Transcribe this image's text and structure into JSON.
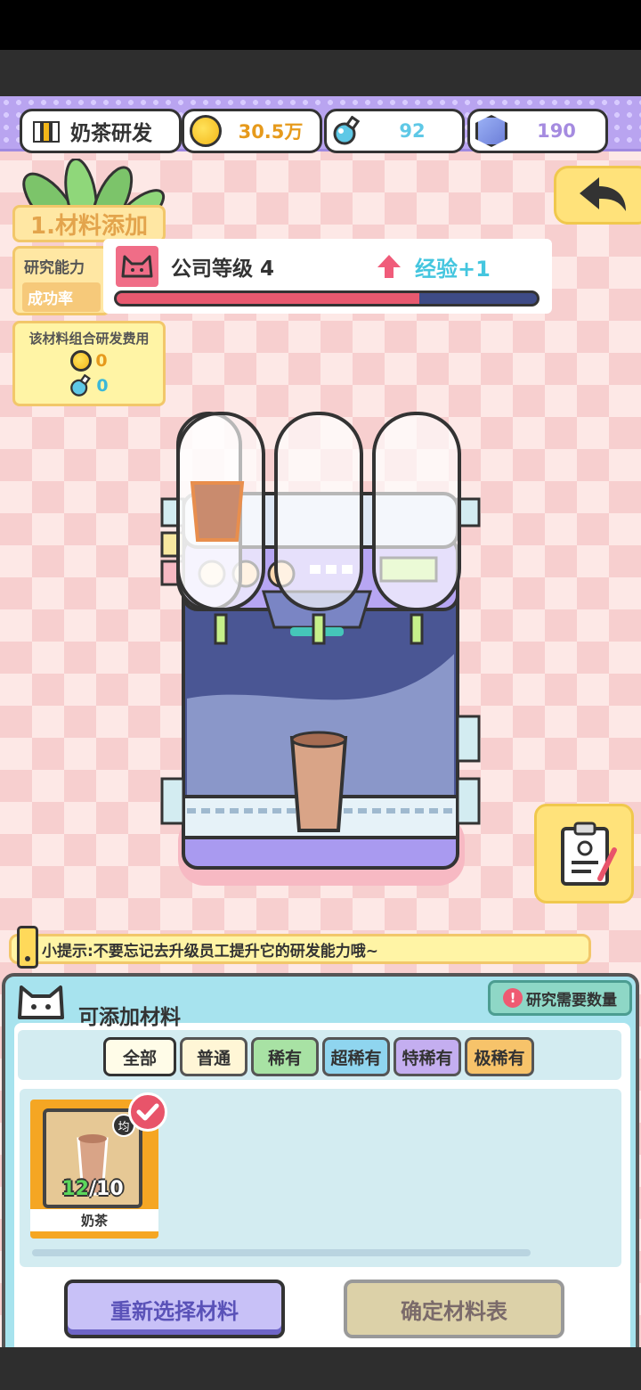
{
  "header": {
    "title": "奶茶研发",
    "coins": "30.5万",
    "potions": "92",
    "gems": "190"
  },
  "section": {
    "label": "1.材料添加"
  },
  "stats": {
    "ability_label": "研究能力",
    "success_label": "成功率"
  },
  "company": {
    "level_text": "公司等级 4",
    "exp_text": "经验+1",
    "exp_progress": 0.72
  },
  "cost": {
    "title": "该材料组合研发费用",
    "coin_cost": "0",
    "potion_cost": "0"
  },
  "tip": {
    "text": "小提示:不要忘记去升级员工提升它的研发能力哦~"
  },
  "materials": {
    "title": "可添加材料",
    "need_button": "研究需要数量",
    "tabs": [
      "全部",
      "普通",
      "稀有",
      "超稀有",
      "特稀有",
      "极稀有"
    ],
    "selected_tab": "全部",
    "items": [
      {
        "name": "奶茶",
        "have": "12",
        "need": "/10",
        "avg_badge": "均",
        "selected": true
      }
    ]
  },
  "actions": {
    "reselect": "重新选择材料",
    "confirm": "确定材料表"
  },
  "colors": {
    "accent_purple": "#b9a4f0",
    "gold": "#f5a623",
    "exp_cyan": "#45c6df",
    "pink": "#e8546a"
  }
}
